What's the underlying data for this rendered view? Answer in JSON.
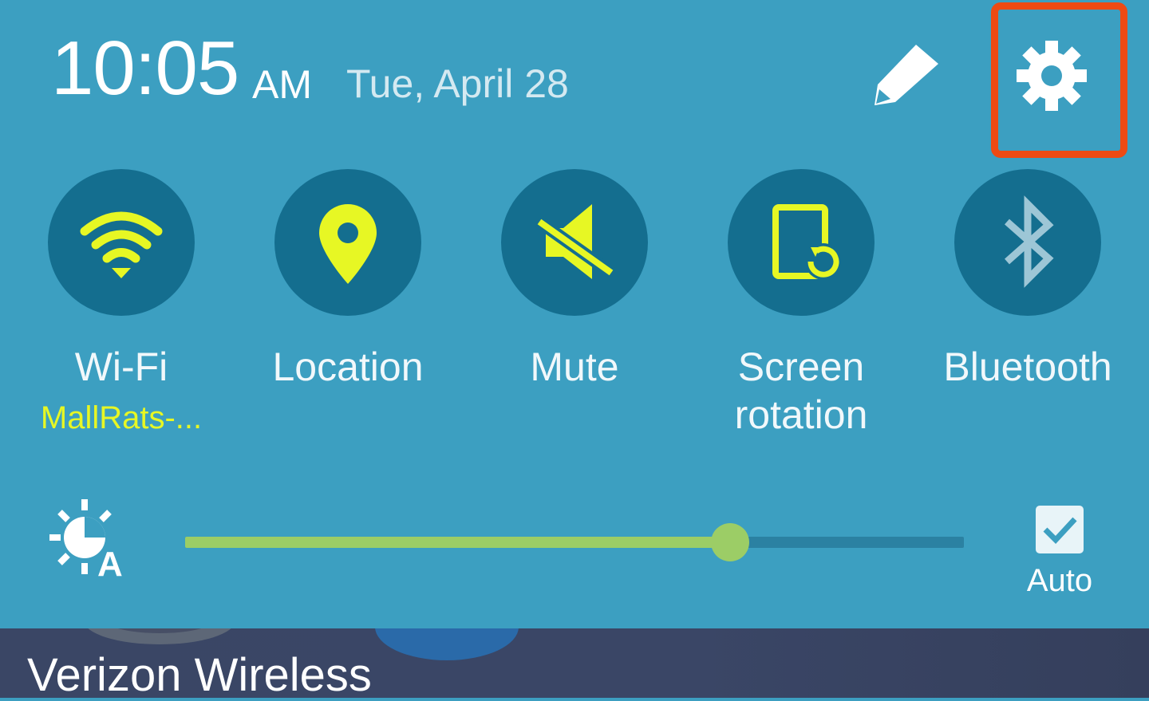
{
  "header": {
    "time": "10:05",
    "ampm": "AM",
    "date": "Tue, April 28",
    "edit_icon": "pencil-icon",
    "settings_icon": "gear-icon",
    "highlight_color": "#ee4a13"
  },
  "toggles": [
    {
      "label": "Wi-Fi",
      "sublabel": "MallRats-...",
      "icon": "wifi-icon",
      "active": true
    },
    {
      "label": "Location",
      "icon": "location-pin-icon",
      "active": true
    },
    {
      "label": "Mute",
      "icon": "mute-icon",
      "active": true
    },
    {
      "label": "Screen rotation",
      "icon": "screen-rotation-icon",
      "active": true
    },
    {
      "label": "Bluetooth",
      "icon": "bluetooth-icon",
      "active": false
    }
  ],
  "brightness": {
    "icon": "auto-brightness-icon",
    "level_fraction": 0.7,
    "auto_checked": true,
    "auto_label": "Auto"
  },
  "carrier": {
    "name": "Verizon Wireless"
  },
  "colors": {
    "panel_bg": "#3c9fc1",
    "toggle_bg": "#146e8f",
    "active_icon": "#e7f724",
    "inactive_icon": "#9dc6d6",
    "slider_fill": "#9ccd66",
    "slider_track": "#2b81a2"
  }
}
